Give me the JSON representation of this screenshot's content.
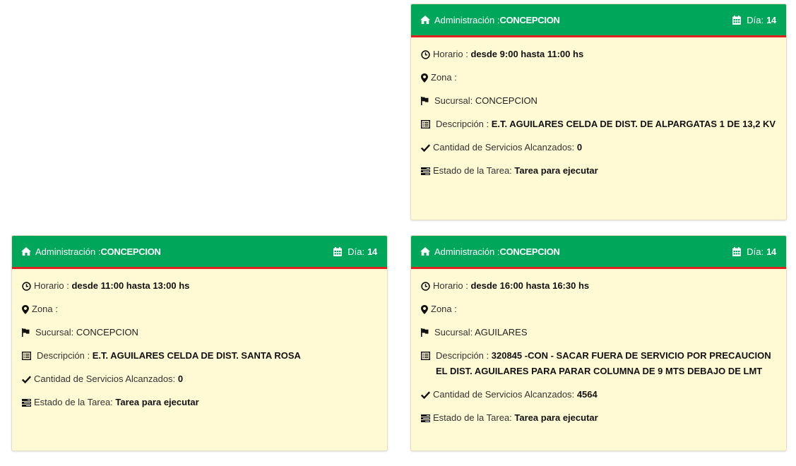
{
  "colors": {
    "header_bg": "#00a65a",
    "header_underline": "#dd2222",
    "card_bg": "#fffad3"
  },
  "labels": {
    "admin": "Administración :",
    "day": "Día:",
    "horario": "Horario",
    "zona": "Zona :",
    "sucursal": "Sucursal:",
    "descripcion": "Descripción :",
    "cantidad": "Cantidad de Servicios Alcanzados:",
    "estado": "Estado de la Tarea:"
  },
  "icons": {
    "header_left": "home-icon",
    "header_right": "calendar-icon",
    "horario": "clock-icon",
    "zona": "map-marker-icon",
    "sucursal": "flag-icon",
    "descripcion": "list-alt-icon",
    "cantidad": "check-icon",
    "estado": "tasks-icon"
  },
  "cards": [
    {
      "admin_value": "CONCEPCION",
      "day_value": "14",
      "horario_value": "desde 9:00 hasta 11:00 hs",
      "zona_value": "",
      "sucursal_value": "CONCEPCION",
      "descripcion_value": "E.T. AGUILARES CELDA DE DIST. DE ALPARGATAS 1 DE 13,2 KV",
      "cantidad_value": "0",
      "estado_value": "Tarea para ejecutar"
    },
    {
      "admin_value": "CONCEPCION",
      "day_value": "14",
      "horario_value": "desde 11:00 hasta 13:00 hs",
      "zona_value": "",
      "sucursal_value": "CONCEPCION",
      "descripcion_value": "E.T. AGUILARES CELDA DE DIST. SANTA ROSA",
      "cantidad_value": "0",
      "estado_value": "Tarea para ejecutar"
    },
    {
      "admin_value": "CONCEPCION",
      "day_value": "14",
      "horario_value": "desde 16:00 hasta 16:30 hs",
      "zona_value": "",
      "sucursal_value": "AGUILARES",
      "descripcion_value": "320845 -CON - SACAR FUERA DE SERVICIO POR PRECAUCION EL DIST. AGUILARES PARA PARAR COLUMNA DE 9 MTS DEBAJO DE LMT",
      "cantidad_value": "4564",
      "estado_value": "Tarea para ejecutar"
    }
  ]
}
